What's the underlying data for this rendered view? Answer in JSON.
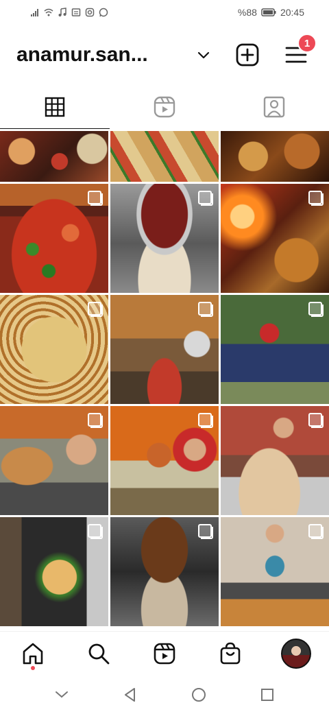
{
  "status": {
    "battery": "%88",
    "time": "20:45"
  },
  "profile": {
    "username": "anamur.san..."
  },
  "notifications": {
    "menu_badge": "1"
  },
  "tabs": [
    {
      "name": "grid",
      "icon": "grid-icon",
      "active": true
    },
    {
      "name": "reels",
      "icon": "reels-icon",
      "active": false
    },
    {
      "name": "tagged",
      "icon": "tagged-icon",
      "active": false
    }
  ],
  "nav": {
    "items": [
      "home-icon",
      "search-icon",
      "reels-icon",
      "shop-icon",
      "profile-avatar"
    ]
  },
  "colors": {
    "badge": "#ed4956",
    "text": "#111111"
  }
}
